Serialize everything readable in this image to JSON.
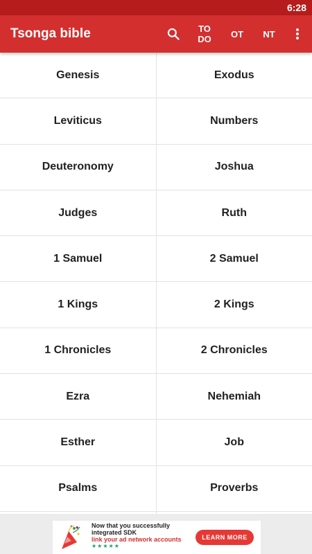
{
  "status_bar": {
    "time": "6:28"
  },
  "app_bar": {
    "title": "Tsonga bible",
    "actions": {
      "search_icon": "search-icon",
      "todo_label": "TO DO",
      "ot_label": "OT",
      "nt_label": "NT",
      "more_icon": "more-vert-icon"
    },
    "color": "#d32f2f",
    "status_color": "#b71c1c"
  },
  "books": [
    [
      "Genesis",
      "Exodus"
    ],
    [
      "Leviticus",
      "Numbers"
    ],
    [
      "Deuteronomy",
      "Joshua"
    ],
    [
      "Judges",
      "Ruth"
    ],
    [
      "1 Samuel",
      "2 Samuel"
    ],
    [
      "1 Kings",
      "2 Kings"
    ],
    [
      "1 Chronicles",
      "2 Chronicles"
    ],
    [
      "Ezra",
      "Nehemiah"
    ],
    [
      "Esther",
      "Job"
    ],
    [
      "Psalms",
      "Proverbs"
    ]
  ],
  "ad": {
    "line1": "Now that you successfully",
    "line1b": "integrated SDK",
    "line2": "link your ad network accounts",
    "stars": "★★★★★",
    "button": "LEARN MORE",
    "button_color": "#e53935"
  }
}
